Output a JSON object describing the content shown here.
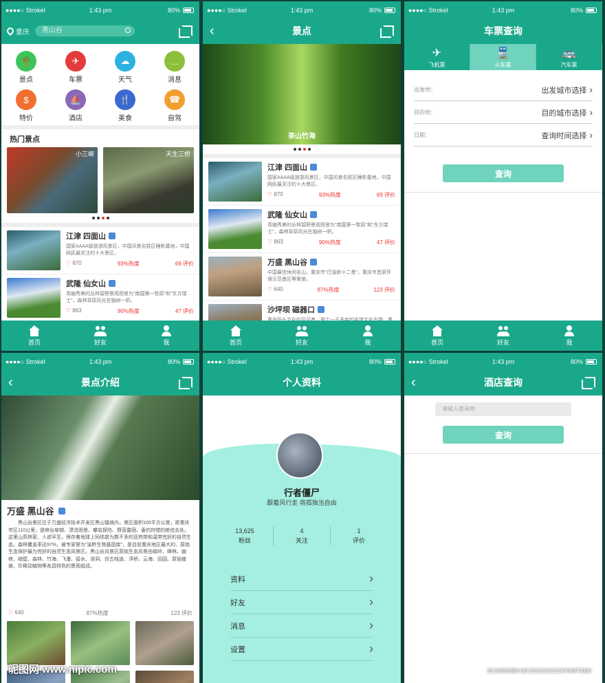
{
  "status": {
    "carrier": "●●●●○ Strokel",
    "time": "1:43 pm",
    "battery": "80%"
  },
  "tabbar": {
    "home": "首页",
    "friends": "好友",
    "me": "我"
  },
  "screen1": {
    "city": "重庆",
    "search": "黑山谷",
    "grid": [
      {
        "label": "景点",
        "color": "#3ec45a",
        "icon": "🌴"
      },
      {
        "label": "车票",
        "color": "#e33b3b",
        "icon": "✈"
      },
      {
        "label": "天气",
        "color": "#2db2e0",
        "icon": "☁"
      },
      {
        "label": "消息",
        "color": "#8cbf3a",
        "icon": "…"
      },
      {
        "label": "特价",
        "color": "#f07030",
        "icon": "$"
      },
      {
        "label": "酒店",
        "color": "#8a6ab8",
        "icon": "⛵"
      },
      {
        "label": "美食",
        "color": "#3a6ad0",
        "icon": "🍴"
      },
      {
        "label": "自驾",
        "color": "#f0a030",
        "icon": "☎"
      }
    ],
    "hot_title": "热门景点",
    "hot": [
      "小三峡",
      "天生三桥"
    ],
    "items": [
      {
        "title": "江津  四面山",
        "desc": "国家AAAA级旅游风景区，中国风景名胜区睡影基地，中国网民最关注的十大景区。",
        "likes": "870",
        "heat": "93%热度",
        "reviews": "69 评价"
      },
      {
        "title": "武隆  仙女山",
        "desc": "青幽秀美的丛林碧野景观而誉为\"南国第一牧原\"和\"东方瑞士\"，森林草原风光在独树一帜。",
        "likes": "863",
        "heat": "90%热度",
        "reviews": "47 评价"
      }
    ]
  },
  "screen2": {
    "title": "景点",
    "banner": "茶山竹海",
    "items": [
      {
        "title": "江津  四面山",
        "desc": "国家AAAA级旅游风景区，中国风景名胜区睡影基地，中国网民最关注的十大景区。",
        "likes": "870",
        "heat": "93%热度",
        "reviews": "69 评价"
      },
      {
        "title": "武隆  仙女山",
        "desc": "青幽秀美的丛林碧野景观而誉为\"南国第一牧原\"和\"东方瑞士\"，森林草原风光在独树一帜。",
        "likes": "863",
        "heat": "90%热度",
        "reviews": "47 评价"
      },
      {
        "title": "万盛  黑山谷",
        "desc": "中国最佳休闲名山，重庆市\"巴渝新十二景\"，重庆市首家环保示范景区等荣誉。",
        "likes": "640",
        "heat": "87%热度",
        "reviews": "123 评价"
      },
      {
        "title": "沙坪坝  磁器口",
        "desc": "重庆码头文化的见证者，是个一千多年的名饼文化古镇，重庆市重点保护对象。",
        "likes": "",
        "heat": "",
        "reviews": ""
      }
    ]
  },
  "screen3": {
    "title": "车票查询",
    "tabs": [
      {
        "label": "飞机票",
        "icon": "✈"
      },
      {
        "label": "火车票",
        "icon": "🚆"
      },
      {
        "label": "汽车票",
        "icon": "🚌"
      }
    ],
    "fields": [
      {
        "key": "出发地：",
        "value": "出发城市选择"
      },
      {
        "key": "目的地：",
        "value": "目的城市选择"
      },
      {
        "key": "日期：",
        "value": "查询时间选择"
      }
    ],
    "button": "查询"
  },
  "screen4": {
    "title": "景点介绍",
    "name": "万盛  黑山谷",
    "desc": "黑山谷景区位于万盛经济技术开发区黑山镇境内，景区面积100平方公里，距重庆市区110公里，是峡谷穿越、漂流观景、攀岩探险、野营露宿、垂钓狩猎的绝佳去处。这里山高林密、人迹罕至，保存着地球上同纬度为数不多的亚热带和温带完好的自然生态，森林覆盖率达97%，被专家誉为\"渝黔生物基因库\"，是目前重庆地区最大的、原始生态保护最为完好的自然生态风景区。黑山谷风景区原始生态风景由峻岭、峰林、幽峡、峭壁、森林、竹海、飞瀑、碧水、溶洞、仿古栈道、浮桥、云海、田园、原始植被、珍稀动植物等各具特色的景观组成。",
    "likes": "640",
    "heat": "87%热度",
    "reviews": "123 评价"
  },
  "screen5": {
    "title": "个人资料",
    "name": "行者僵尸",
    "motto": "跟着风行走  将孤独当自由",
    "stats": [
      {
        "num": "13,625",
        "label": "粉丝"
      },
      {
        "num": "4",
        "label": "关注"
      },
      {
        "num": "1",
        "label": "评价"
      }
    ],
    "menu": [
      "资料",
      "好友",
      "消息",
      "设置"
    ]
  },
  "screen6": {
    "title": "酒店查询",
    "placeholder": "请输入查询地",
    "button": "查询"
  },
  "watermark": {
    "left": "昵图网 www.nipic.com",
    "right": "ID:20359390 NO:20151013124704874000"
  }
}
